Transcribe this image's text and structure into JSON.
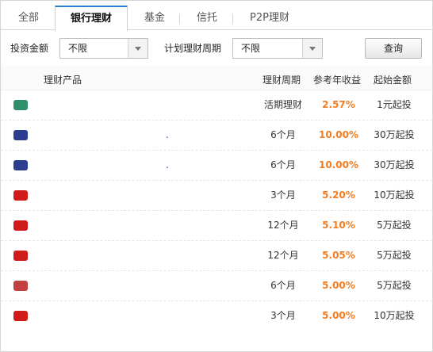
{
  "tabs": [
    {
      "label": "全部"
    },
    {
      "label": "银行理财",
      "active": true
    },
    {
      "label": "基金"
    },
    {
      "label": "信托"
    },
    {
      "label": "P2P理财"
    }
  ],
  "filters": {
    "amount_label": "投资金额",
    "amount_value": "不限",
    "period_label": "计划理财周期",
    "period_value": "不限",
    "query_label": "查询"
  },
  "table": {
    "headers": {
      "name": "理财产品",
      "period": "理财周期",
      "yield": "参考年收益",
      "min": "起始金额"
    },
    "rows": [
      {
        "name": "",
        "period": "活期理财",
        "yield": "2.57%",
        "min": "1元起投",
        "logo_color": "#2f8f6a"
      },
      {
        "name": ".",
        "period": "6个月",
        "yield": "10.00%",
        "min": "30万起投",
        "logo_color": "#2a3d8f"
      },
      {
        "name": ".",
        "period": "6个月",
        "yield": "10.00%",
        "min": "30万起投",
        "logo_color": "#2a3d8f"
      },
      {
        "name": "",
        "period": "3个月",
        "yield": "5.20%",
        "min": "10万起投",
        "logo_color": "#d11b1b"
      },
      {
        "name": "",
        "period": "12个月",
        "yield": "5.10%",
        "min": "5万起投",
        "logo_color": "#d11b1b"
      },
      {
        "name": "",
        "period": "12个月",
        "yield": "5.05%",
        "min": "5万起投",
        "logo_color": "#d11b1b"
      },
      {
        "name": "",
        "period": "6个月",
        "yield": "5.00%",
        "min": "5万起投",
        "logo_color": "#c24040"
      },
      {
        "name": "",
        "period": "3个月",
        "yield": "5.00%",
        "min": "10万起投",
        "logo_color": "#d11b1b"
      }
    ]
  }
}
